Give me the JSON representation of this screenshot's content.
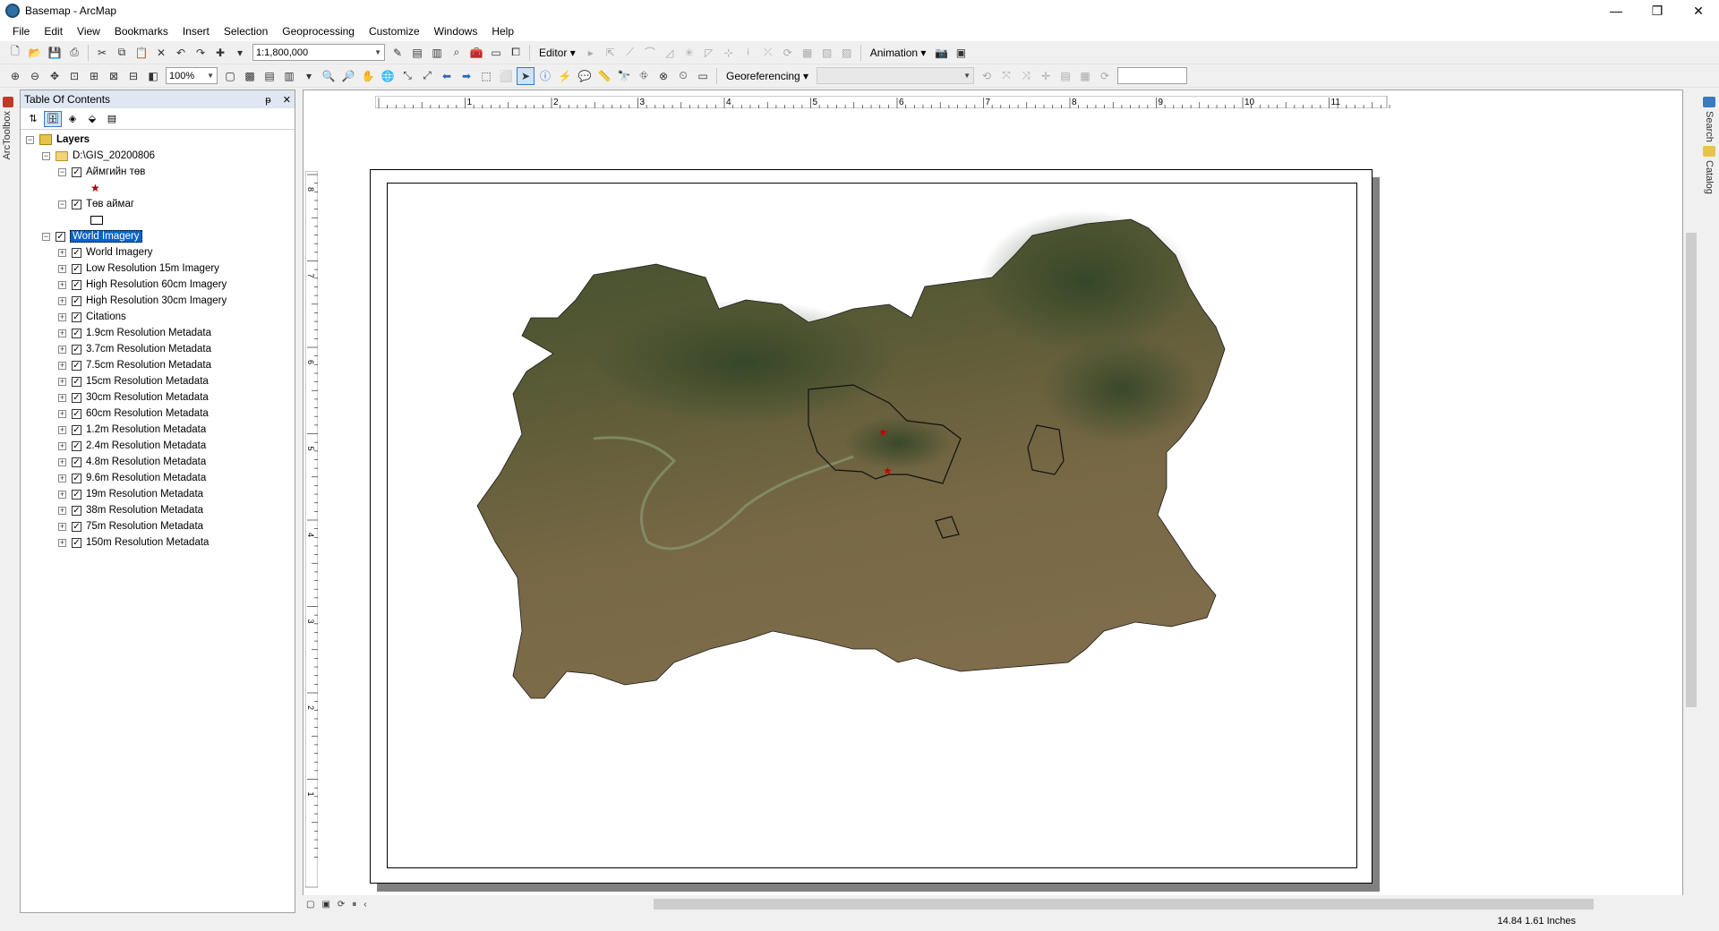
{
  "window": {
    "title": "Basemap - ArcMap",
    "controls": [
      "—",
      "❐",
      "✕"
    ]
  },
  "menu": [
    "File",
    "Edit",
    "View",
    "Bookmarks",
    "Insert",
    "Selection",
    "Geoprocessing",
    "Customize",
    "Windows",
    "Help"
  ],
  "toolbar": {
    "scale_value": "1:1,800,000",
    "zoom_value": "100%",
    "editor_label": "Editor",
    "animation_label": "Animation",
    "georeferencing_label": "Georeferencing"
  },
  "left_toolbox": {
    "label": "ArcToolbox"
  },
  "right_dock": {
    "search_label": "Search",
    "catalog_label": "Catalog"
  },
  "toc": {
    "title": "Table Of Contents",
    "pin": "ᵽ",
    "close": "✕",
    "root": "Layers",
    "folder": "D:\\GIS_20200806",
    "group_layers": [
      {
        "name": "Аймгийн төв"
      },
      {
        "name": "Төв аймаг"
      }
    ],
    "basemap_layer": "World Imagery",
    "basemap_sublayers": [
      "World Imagery",
      "Low Resolution 15m Imagery",
      "High Resolution 60cm Imagery",
      "High Resolution 30cm Imagery",
      "Citations",
      "1.9cm Resolution Metadata",
      "3.7cm Resolution Metadata",
      "7.5cm Resolution Metadata",
      "15cm Resolution Metadata",
      "30cm Resolution Metadata",
      "60cm Resolution Metadata",
      "1.2m Resolution Metadata",
      "2.4m Resolution Metadata",
      "4.8m Resolution Metadata",
      "9.6m Resolution Metadata",
      "19m Resolution Metadata",
      "38m Resolution Metadata",
      "75m Resolution Metadata",
      "150m Resolution Metadata"
    ]
  },
  "ruler": {
    "h_ticks": [
      "1",
      "2",
      "3",
      "4",
      "5",
      "6",
      "7",
      "8",
      "9",
      "10",
      "11"
    ],
    "v_ticks": [
      "8",
      "7",
      "6",
      "5",
      "4",
      "3",
      "2",
      "1"
    ]
  },
  "status": {
    "coordinates": "14.84  1.61 Inches"
  },
  "colors": {
    "selection": "#0a64c8",
    "marker": "#c00000",
    "imagery": "#6e6440"
  }
}
